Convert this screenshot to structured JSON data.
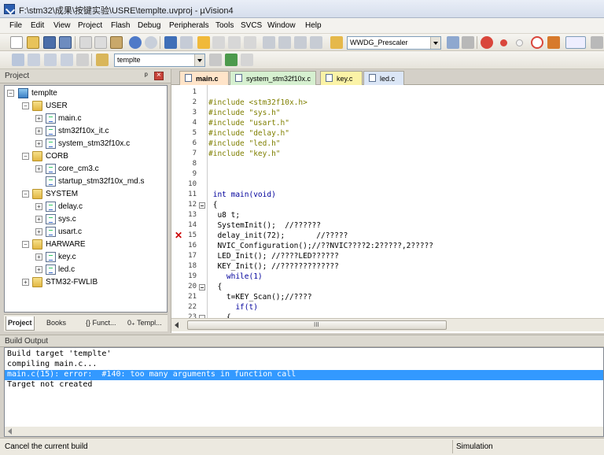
{
  "window": {
    "title": "F:\\stm32\\成果\\按键实验\\USRE\\templte.uvproj - µVision4"
  },
  "menu": [
    "File",
    "Edit",
    "View",
    "Project",
    "Flash",
    "Debug",
    "Peripherals",
    "Tools",
    "SVCS",
    "Window",
    "Help"
  ],
  "toolbar": {
    "function_combo": "WWDG_Prescaler",
    "target_combo": "templte"
  },
  "project_pane": {
    "title": "Project",
    "pin": "ᵖ",
    "tree": [
      {
        "label": "templte",
        "icon": "project-root-icon",
        "expander": "−"
      },
      {
        "label": "USER",
        "icon": "folder-icon",
        "expander": "−"
      },
      {
        "label": "main.c",
        "icon": "c-file-icon",
        "expander": "+"
      },
      {
        "label": "stm32f10x_it.c",
        "icon": "c-file-icon",
        "expander": "+"
      },
      {
        "label": "system_stm32f10x.c",
        "icon": "c-file-icon",
        "expander": "+"
      },
      {
        "label": "CORB",
        "icon": "folder-icon",
        "expander": "−"
      },
      {
        "label": "core_cm3.c",
        "icon": "c-file-icon",
        "expander": "+"
      },
      {
        "label": "startup_stm32f10x_md.s",
        "icon": "asm-file-icon",
        "expander": ""
      },
      {
        "label": "SYSTEM",
        "icon": "folder-icon",
        "expander": "−"
      },
      {
        "label": "delay.c",
        "icon": "c-file-icon",
        "expander": "+"
      },
      {
        "label": "sys.c",
        "icon": "c-file-icon",
        "expander": "+"
      },
      {
        "label": "usart.c",
        "icon": "c-file-icon",
        "expander": "+"
      },
      {
        "label": "HARWARE",
        "icon": "folder-icon",
        "expander": "−"
      },
      {
        "label": "key.c",
        "icon": "c-file-icon",
        "expander": "+"
      },
      {
        "label": "led.c",
        "icon": "c-file-icon",
        "expander": "+"
      },
      {
        "label": "STM32-FWLIB",
        "icon": "folder-icon",
        "expander": "+"
      }
    ],
    "tabs": [
      "Project",
      "Books",
      "{} Funct...",
      "0₊ Templ..."
    ]
  },
  "editor": {
    "tabs": [
      "main.c",
      "system_stm32f10x.c",
      "key.c",
      "led.c"
    ],
    "scroll_grip": "III",
    "error_marker": "✕",
    "line_numbers": [
      "1",
      "2",
      "3",
      "4",
      "5",
      "6",
      "7",
      "8",
      "9",
      "10",
      "11",
      "12",
      "13",
      "14",
      "15",
      "16",
      "17",
      "18",
      "19",
      "20",
      "21",
      "22",
      "23"
    ],
    "lines": [
      "",
      "#include <stm32f10x.h>",
      "#include \"sys.h\"",
      "#include \"usart.h\"",
      "#include \"delay.h\"",
      "#include \"led.h\"",
      "#include \"key.h\"",
      "",
      "",
      "",
      " int main(void)",
      " {",
      "  u8 t;",
      "  SystemInit();  //??????",
      "  delay_init(72);       //?????",
      "  NVIC_Configuration();//??NVIC????2:2?????,2?????",
      "  LED_Init(); //????LED??????",
      "  KEY_Init(); //?????????????",
      "    while(1)",
      "  {",
      "    t=KEY_Scan();//????",
      "      if(t)",
      "    {"
    ]
  },
  "build_output": {
    "title": "Build Output",
    "lines": [
      "Build target 'templte'",
      "compiling main.c...",
      "main.c(15): error:  #140: too many arguments in function call",
      "Target not created"
    ]
  },
  "status": {
    "left": "Cancel the current build",
    "right": "Simulation"
  }
}
